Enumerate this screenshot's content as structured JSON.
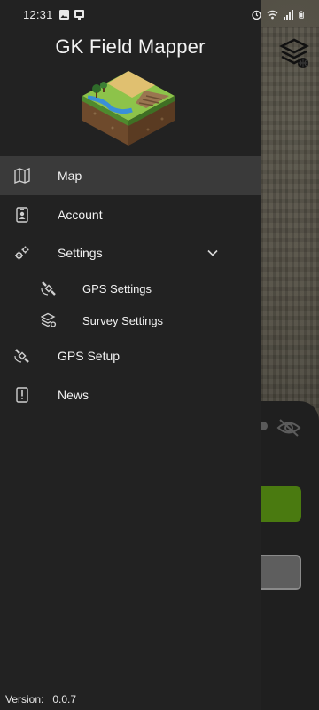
{
  "status_bar": {
    "time": "12:31",
    "left_icons": [
      "image-icon",
      "cast-icon"
    ],
    "right_icons": [
      "alarm-icon",
      "wifi-icon",
      "signal-icon",
      "battery-icon"
    ]
  },
  "drawer": {
    "title": "GK Field Mapper",
    "logo_icon": "isometric-terrain-logo",
    "items": [
      {
        "key": "map",
        "label": "Map",
        "icon": "map-icon",
        "active": true
      },
      {
        "key": "account",
        "label": "Account",
        "icon": "badge-icon"
      },
      {
        "key": "settings",
        "label": "Settings",
        "icon": "gears-icon",
        "expanded": true,
        "children": [
          {
            "key": "gps-settings",
            "label": "GPS Settings",
            "icon": "satellite-icon"
          },
          {
            "key": "survey-settings",
            "label": "Survey Settings",
            "icon": "layers-gear-icon"
          }
        ]
      },
      {
        "key": "gps-setup",
        "label": "GPS Setup",
        "icon": "satellite-icon"
      },
      {
        "key": "news",
        "label": "News",
        "icon": "alert-box-icon"
      }
    ],
    "version_label": "Version:",
    "version_value": "0.0.7"
  },
  "colors": {
    "drawer_bg": "#222222",
    "active_item_bg": "#3a3a3a",
    "accent_green": "#4a7a10"
  }
}
